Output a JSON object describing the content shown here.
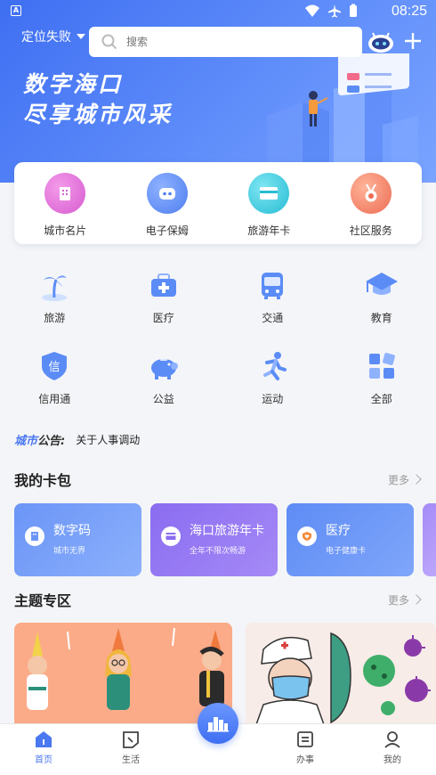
{
  "status_bar": {
    "time": "08:25"
  },
  "header": {
    "location": "定位失败",
    "search_placeholder": "搜索",
    "banner_line1": "数字海口",
    "banner_line2": "尽享城市风采"
  },
  "quick_services": [
    {
      "label": "城市名片",
      "icon": "building-icon",
      "color": "#e36bd8"
    },
    {
      "label": "电子保姆",
      "icon": "robot-icon",
      "color": "#5b8cf6"
    },
    {
      "label": "旅游年卡",
      "icon": "card-icon",
      "color": "#34c5d8"
    },
    {
      "label": "社区服务",
      "icon": "medal-icon",
      "color": "#f07a5e"
    }
  ],
  "grid_services": [
    {
      "label": "旅游",
      "icon": "palm-tree-icon"
    },
    {
      "label": "医疗",
      "icon": "medical-kit-icon"
    },
    {
      "label": "交通",
      "icon": "bus-icon"
    },
    {
      "label": "教育",
      "icon": "graduation-cap-icon"
    },
    {
      "label": "信用通",
      "icon": "credit-shield-icon"
    },
    {
      "label": "公益",
      "icon": "piggy-bank-icon"
    },
    {
      "label": "运动",
      "icon": "runner-icon"
    },
    {
      "label": "全部",
      "icon": "all-apps-icon"
    }
  ],
  "notice": {
    "tag_a": "城市",
    "tag_b": "公告:",
    "text": "关于人事调动"
  },
  "wallet": {
    "title": "我的卡包",
    "more": "更多",
    "cards": [
      {
        "title": "数字码",
        "subtitle": "城市无界",
        "color": "#6b95f7"
      },
      {
        "title": "海口旅游年卡",
        "subtitle": "全年不限次畅游",
        "color": "#8a6cf0"
      },
      {
        "title": "医疗",
        "subtitle": "电子健康卡",
        "color": "#5e8cf5"
      }
    ]
  },
  "themes": {
    "title": "主题专区",
    "more": "更多"
  },
  "tabbar": [
    {
      "label": "首页",
      "icon": "home-icon"
    },
    {
      "label": "生活",
      "icon": "life-icon"
    },
    {
      "label": "办事",
      "icon": "tasks-icon"
    },
    {
      "label": "我的",
      "icon": "profile-icon"
    }
  ]
}
